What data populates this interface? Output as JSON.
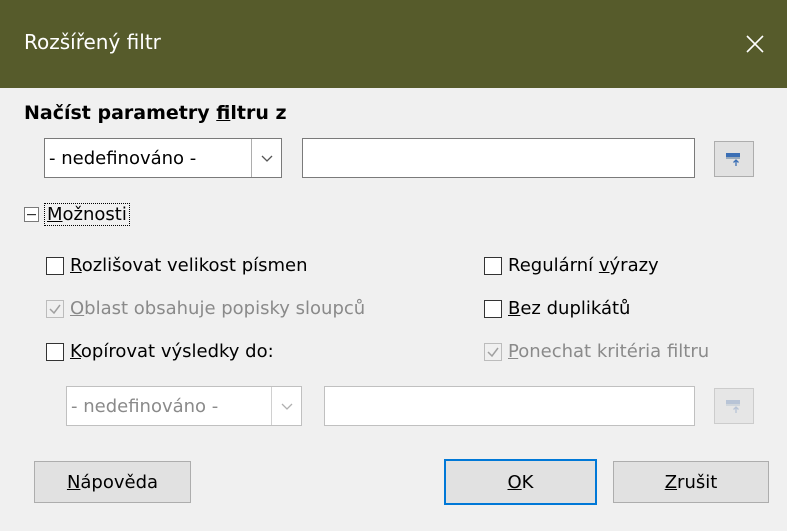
{
  "window": {
    "title": "Rozšířený filtr",
    "close_icon": "close-icon"
  },
  "load_params": {
    "heading_pre": "Načíst parametry ",
    "heading_mnemonic": "f",
    "heading_post": "iltru z",
    "combo_value": "- nedefinováno -",
    "text_value": "",
    "shrink_icon": "shrink-icon"
  },
  "options": {
    "expander_mnemonic": "M",
    "expander_rest": "ožnosti",
    "expanded": true,
    "case_sensitive": {
      "mnemonic": "R",
      "rest": "ozlišovat velikost písmen",
      "checked": false,
      "enabled": true
    },
    "has_headers": {
      "mnemonic": "O",
      "rest": "blast obsahuje popisky sloupců",
      "checked": true,
      "enabled": false
    },
    "copy_results": {
      "mnemonic": "K",
      "rest": "opírovat výsledky do:",
      "checked": false,
      "enabled": true
    },
    "regex": {
      "pre": "Regulární ",
      "mnemonic": "v",
      "rest": "ýrazy",
      "checked": false,
      "enabled": true
    },
    "no_duplicates": {
      "mnemonic": "B",
      "rest": "ez duplikátů",
      "checked": false,
      "enabled": true
    },
    "keep_criteria": {
      "mnemonic": "P",
      "rest": "onechat kritéria filtru",
      "checked": true,
      "enabled": false
    },
    "copy_combo_value": "- nedefinováno -",
    "copy_text_value": ""
  },
  "buttons": {
    "help": {
      "mnemonic": "N",
      "rest": "ápověda"
    },
    "ok": {
      "mnemonic": "O",
      "rest": "K"
    },
    "cancel": {
      "mnemonic": "Z",
      "rest": "rušit"
    }
  },
  "colors": {
    "titlebar": "#565b2b",
    "dialog_bg": "#f0f0f0",
    "default_button_border": "#0078d7",
    "disabled_text": "#8a8a8a"
  }
}
